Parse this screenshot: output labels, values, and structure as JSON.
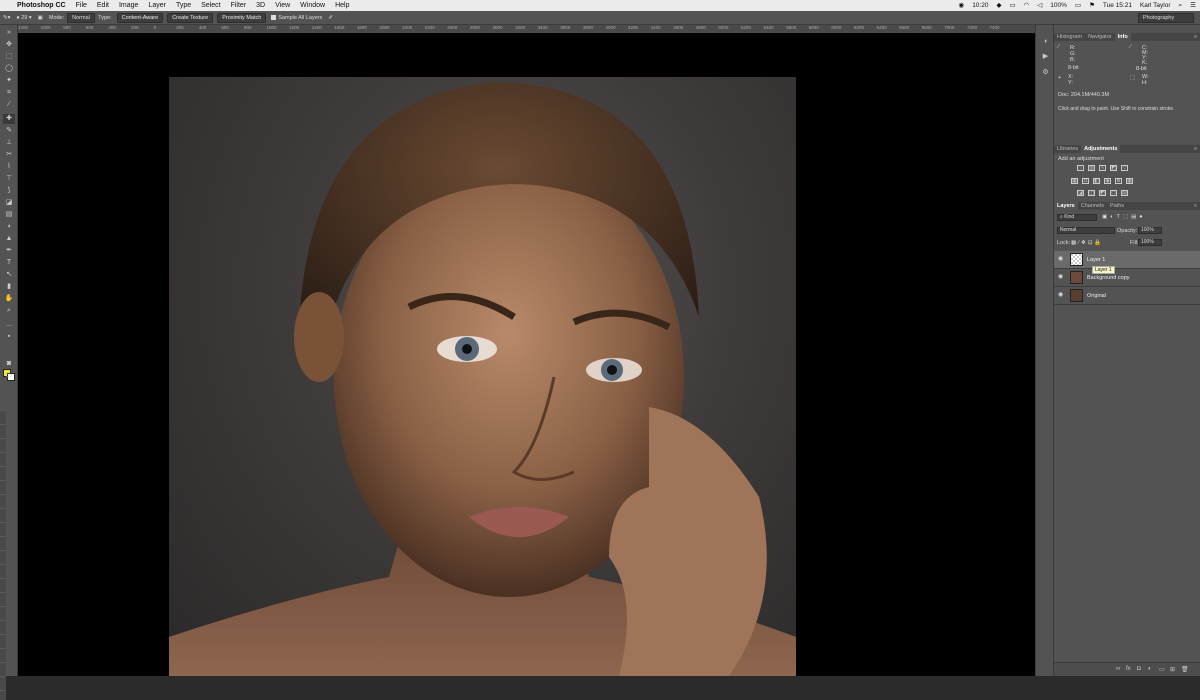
{
  "menubar": {
    "app_name": "Photoshop CC",
    "items": [
      "File",
      "Edit",
      "Image",
      "Layer",
      "Type",
      "Select",
      "Filter",
      "3D",
      "View",
      "Window",
      "Help"
    ],
    "clock_left": "10:20",
    "battery": "100%",
    "time": "Tue 15:21",
    "user": "Karl Taylor"
  },
  "options_bar": {
    "brush_size": "29",
    "mode_label": "Mode:",
    "mode_value": "Normal",
    "type_label": "Type:",
    "type_buttons": [
      "Content-Aware",
      "Create Texture",
      "Proximity Match"
    ],
    "sample_all_layers": "Sample All Layers",
    "workspace": "Photography"
  },
  "ruler_ticks": [
    "1200",
    "1000",
    "800",
    "600",
    "400",
    "200",
    "0",
    "200",
    "400",
    "600",
    "800",
    "1000",
    "1200",
    "1400",
    "1600",
    "1800",
    "2000",
    "2200",
    "2400",
    "2600",
    "2800",
    "3000",
    "3200",
    "3400",
    "3600",
    "3800",
    "4000",
    "4200",
    "4400",
    "4600",
    "4800",
    "5000",
    "5200",
    "5400",
    "5600",
    "5800",
    "6000",
    "6200",
    "6400",
    "6600",
    "6800",
    "7000",
    "7200",
    "7400"
  ],
  "info_panel": {
    "tabs": [
      "Histogram",
      "Navigator",
      "Info"
    ],
    "active_tab": "Info",
    "labels_left": [
      "R:",
      "G:",
      "B:",
      "8-bit"
    ],
    "labels_right": [
      "C:",
      "M:",
      "Y:",
      "K:",
      "8-bit"
    ],
    "xy_label": [
      "X:",
      "Y:"
    ],
    "wh_label": [
      "W:",
      "H:"
    ],
    "doc": "Doc: 204.1M/440.3M",
    "hint": "Click and drag to paint. Use Shift to constrain stroke."
  },
  "adjustments_panel": {
    "tabs": [
      "Libraries",
      "Adjustments"
    ],
    "active_tab": "Adjustments",
    "heading": "Add an adjustment"
  },
  "layers_panel": {
    "tabs": [
      "Layers",
      "Channels",
      "Paths"
    ],
    "active_tab": "Layers",
    "kind_filter": "Kind",
    "blend_mode": "Normal",
    "opacity_label": "Opacity:",
    "opacity_value": "100%",
    "lock_label": "Lock:",
    "fill_label": "Fill:",
    "fill_value": "100%",
    "layers": [
      {
        "name": "Layer 1",
        "selected": true
      },
      {
        "name": "Background copy",
        "selected": false
      },
      {
        "name": "Original",
        "selected": false
      }
    ],
    "tooltip": "Layer 1"
  },
  "colors": {
    "foreground": "#f3e23a",
    "background": "#ffffff",
    "panel_bg": "#535353",
    "canvas_bg": "#000000"
  }
}
